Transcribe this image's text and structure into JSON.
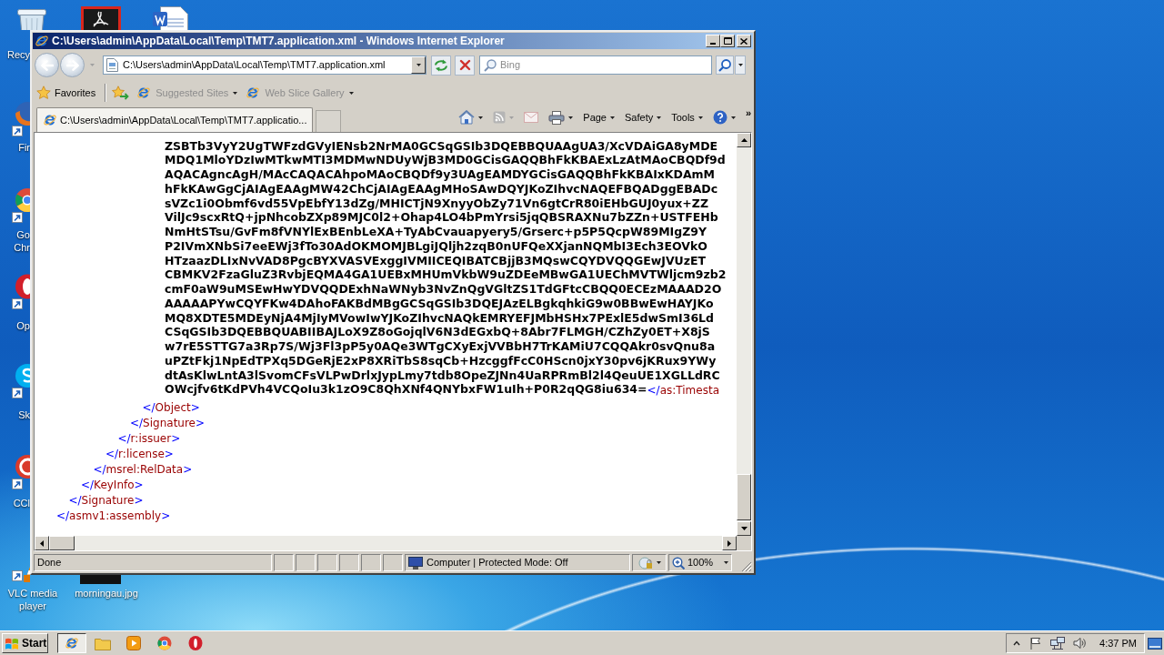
{
  "desktop_icons": [
    {
      "kind": "recycle-bin",
      "label": "Recy"
    },
    {
      "kind": "pdf"
    },
    {
      "kind": "word"
    },
    {
      "kind": "firefox",
      "label": "Fir"
    },
    {
      "kind": "chrome",
      "label": "Go Chr"
    },
    {
      "kind": "opera",
      "label": "Op"
    },
    {
      "kind": "skype",
      "label": "Sk"
    },
    {
      "kind": "ccleaner",
      "label": "CCl"
    },
    {
      "kind": "vlc",
      "label": "VLC media player"
    },
    {
      "kind": "image",
      "label": "morningau.jpg"
    }
  ],
  "window": {
    "title": "C:\\Users\\admin\\AppData\\Local\\Temp\\TMT7.application.xml - Windows Internet Explorer"
  },
  "navigation": {
    "address": "C:\\Users\\admin\\AppData\\Local\\Temp\\TMT7.application.xml",
    "search": {
      "placeholder": "Bing"
    }
  },
  "favorites_bar": {
    "label": "Favorites",
    "items": [
      {
        "label": "Suggested Sites",
        "disabled": true,
        "dropdown": true
      },
      {
        "label": "Web Slice Gallery",
        "disabled": true,
        "dropdown": true
      }
    ]
  },
  "tabs": [
    {
      "label": "C:\\Users\\admin\\AppData\\Local\\Temp\\TMT7.applicatio...",
      "selected": true
    }
  ],
  "command_bar": {
    "items": [
      {
        "kind": "home",
        "dropdown": true,
        "disabled": false
      },
      {
        "kind": "feeds",
        "dropdown": true,
        "disabled": true
      },
      {
        "kind": "mail",
        "dropdown": false,
        "disabled": true
      },
      {
        "kind": "print",
        "dropdown": true,
        "disabled": false
      },
      {
        "kind": "menu",
        "label": "Page",
        "dropdown": true,
        "disabled": false
      },
      {
        "kind": "menu",
        "label": "Safety",
        "dropdown": true,
        "disabled": false
      },
      {
        "kind": "menu",
        "label": "Tools",
        "dropdown": true,
        "disabled": false
      },
      {
        "kind": "help",
        "dropdown": true,
        "disabled": false
      }
    ],
    "overflow": "»"
  },
  "document": {
    "kind": "element",
    "close_tag": "</asmv1:assembly>",
    "children": [
      {
        "kind": "element",
        "close_tag": "</Signature>",
        "children": [
          {
            "kind": "element",
            "close_tag": "</KeyInfo>",
            "children": [
              {
                "kind": "element",
                "close_tag": "</msrel:RelData>",
                "children": [
                  {
                    "kind": "element",
                    "close_tag": "</r:license>",
                    "children": [
                      {
                        "kind": "element",
                        "close_tag": "</r:issuer>",
                        "children": [
                          {
                            "kind": "element",
                            "close_tag": "</Signature>",
                            "children": [
                              {
                                "kind": "element",
                                "close_tag": "</Object>",
                                "children": [
                                  {
                                    "kind": "text",
                                    "close_tag": "</as:Timesta",
                                    "lines": [
                                      "ZSBTb3VyY2UgTWFzdGVyIENsb2NrMA0GCSqGSIb3DQEBBQUAAgUA3/XcVDAiGA8yMDE",
                                      "MDQ1MloYDzIwMTkwMTI3MDMwNDUyWjB3MD0GCisGAQQBhFkKBAExLzAtMAoCBQDf9d",
                                      "AQACAgncAgH/MAcCAQACAhpoMAoCBQDf9y3UAgEAMDYGCisGAQQBhFkKBAIxKDAmM",
                                      "hFkKAwGgCjAIAgEAAgMW42ChCjAIAgEAAgMHoSAwDQYJKoZIhvcNAQEFBQADggEBADc",
                                      "sVZc1i0Obmf6vd55VpEbfY13dZg/MHICTjN9XnyyObZy71Vn6gtCrR80iEHbGUJ0yux+ZZ",
                                      "VilJc9scxRtQ+jpNhcobZXp89MJC0l2+Ohap4LO4bPmYrsi5jqQBSRAXNu7bZZn+USTFEHb",
                                      "NmHtSTsu/GvFm8fVNYlExBEnbLeXA+TyAbCvauapyery5/Grserc+p5P5QcpW89MIgZ9Y",
                                      "P2IVmXNbSi7eeEWj3fTo30AdOKMOMJBLgiJQljh2zqB0nUFQeXXjanNQMbI3Ech3EOVkO",
                                      "HTzaazDLIxNvVAD8PgcBYXVASVExggIVMIICEQIBATCBjjB3MQswCQYDVQQGEwJVUzET",
                                      "CBMKV2FzaGluZ3RvbjEQMA4GA1UEBxMHUmVkbW9uZDEeMBwGA1UEChMVTWljcm9zb2",
                                      "cmF0aW9uMSEwHwYDVQQDExhNaWNyb3NvZnQgVGltZS1TdGFtcCBQQ0ECEzMAAAD2O",
                                      "AAAAAPYwCQYFKw4DAhoFAKBdMBgGCSqGSIb3DQEJAzELBgkqhkiG9w0BBwEwHAYJKo",
                                      "MQ8XDTE5MDEyNjA4MjIyMVowIwYJKoZIhvcNAQkEMRYEFJMbHSHx7PExlE5dwSmI36Ld",
                                      "CSqGSIb3DQEBBQUABIIBAJLoX9Z8oGojqlV6N3dEGxbQ+8Abr7FLMGH/CZhZy0ET+X8jS",
                                      "w7rE5STTG7a3Rp7S/Wj3Fl3pP5y0AQe3WTgCXyExjVVBbH7TrKAMiU7CQQAkr0svQnu8a",
                                      "uPZtFkj1NpEdTPXq5DGeRjE2xP8XRiTbS8sqCb+HzcggfFcC0HScn0jxY30pv6jKRux9YWy",
                                      "dtAsKlwLntA3lSvomCFsVLPwDrlxJypLmy7tdb8OpeZJNn4UaRPRmBl2l4QeuUE1XGLLdRC",
                                      "OWcjfv6tKdPVh4VCQoIu3k1zO9C8QhXNf4QNYbxFW1uIh+P0R2qQG8iu634="
                                    ]
                                  }
                                ]
                              }
                            ]
                          }
                        ]
                      }
                    ]
                  }
                ]
              }
            ]
          }
        ]
      }
    ]
  },
  "status_bar": {
    "text": "Done",
    "zone": "Computer | Protected Mode: Off",
    "zoom": "100%"
  },
  "taskbar": {
    "start": "Start",
    "apps": [
      {
        "kind": "browser",
        "selected": true
      },
      {
        "kind": "folder",
        "selected": false
      },
      {
        "kind": "media-player",
        "selected": false
      },
      {
        "kind": "chrome",
        "selected": false
      },
      {
        "kind": "opera",
        "selected": false
      }
    ],
    "clock": "4:37 PM"
  }
}
